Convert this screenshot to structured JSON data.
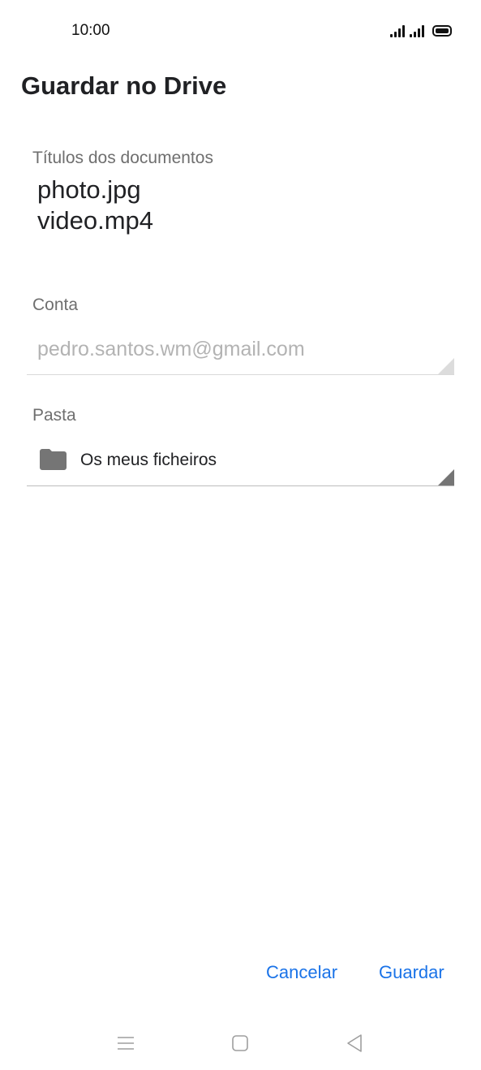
{
  "status_bar": {
    "time": "10:00",
    "icons": [
      "signal-icon",
      "signal-icon",
      "battery-icon"
    ]
  },
  "dialog": {
    "title": "Guardar no Drive",
    "documents": {
      "label": "Títulos dos documentos",
      "items": [
        "photo.jpg",
        "video.mp4"
      ]
    },
    "account": {
      "label": "Conta",
      "value": "pedro.santos.wm@gmail.com"
    },
    "folder": {
      "label": "Pasta",
      "value": "Os meus ficheiros",
      "icon": "folder-icon"
    },
    "buttons": {
      "cancel": "Cancelar",
      "save": "Guardar"
    }
  },
  "nav_bar": {
    "icons": [
      "menu-icon",
      "home-icon",
      "back-icon"
    ]
  },
  "colors": {
    "accent": "#1a73e8",
    "text_primary": "#202124",
    "text_secondary": "#6f6f6f",
    "text_disabled": "#b3b3b3"
  }
}
